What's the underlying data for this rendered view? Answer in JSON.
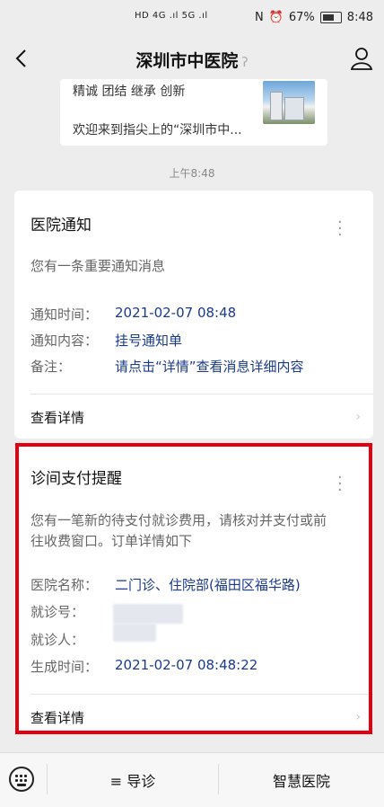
{
  "status_bar": {
    "network": "HD 4G .ıl 5G .ıl",
    "nfc": "N",
    "battery_percent": "67%",
    "time": "8:48"
  },
  "header": {
    "title": "深圳市中医院",
    "back_icon": "chevron-left-icon",
    "profile_icon": "person-icon"
  },
  "article": {
    "slogan": "精诚 团结 继承 创新",
    "desc": "欢迎来到指尖上的“深圳市中..."
  },
  "timestamp": "上午8:48",
  "card1": {
    "title": "医院通知",
    "intro": "您有一条重要通知消息",
    "rows": [
      {
        "key": "通知时间：",
        "value": "2021-02-07 08:48"
      },
      {
        "key": "通知内容：",
        "value": "挂号通知单"
      },
      {
        "key": "备注：",
        "value": "请点击“详情”查看消息详细内容"
      }
    ],
    "detail_label": "查看详情"
  },
  "card2": {
    "title": "诊间支付提醒",
    "intro_line1": "您有一笔新的待支付就诊费用，请核对并支付或前",
    "intro_line2": "往收费窗口。订单详情如下",
    "rows": [
      {
        "key": "医院名称：",
        "value": "二门诊、住院部(福田区福华路)"
      },
      {
        "key": "就诊号：",
        "value": ""
      },
      {
        "key": "就诊人：",
        "value": ""
      },
      {
        "key": "生成时间：",
        "value": "2021-02-07 08:48:22"
      }
    ],
    "detail_label": "查看详情"
  },
  "bottom_menu": {
    "keyboard_icon": "keyboard-icon",
    "item1": "≡ 导诊",
    "item2": "智慧医院"
  },
  "colors": {
    "highlight": "#e4000f",
    "value_text": "#1a3a8c"
  }
}
